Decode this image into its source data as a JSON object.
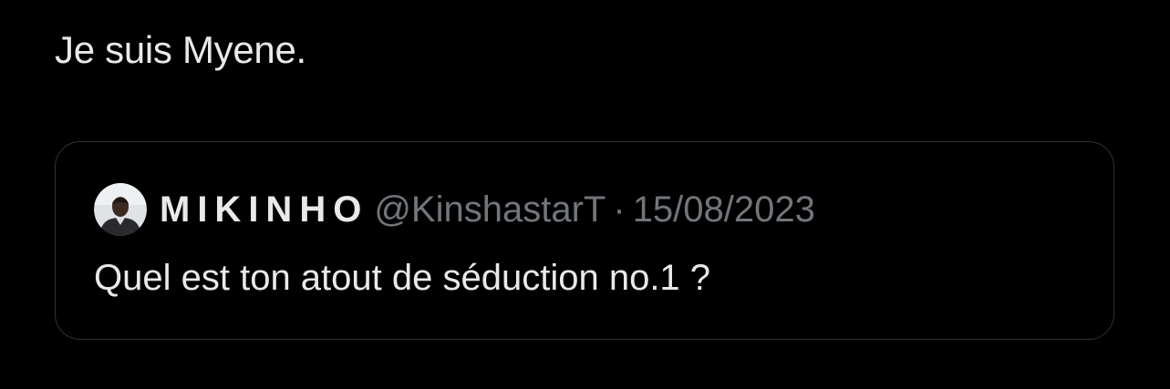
{
  "tweet": {
    "text": "Je suis Myene."
  },
  "quoted_tweet": {
    "display_name": "MIKINHO",
    "handle": "@KinshastarT",
    "separator": "·",
    "date": "15/08/2023",
    "text": "Quel est ton atout de séduction no.1 ?",
    "avatar_icon": "user-avatar-photo"
  },
  "colors": {
    "background": "#000000",
    "primary_text": "#e7e9ea",
    "secondary_text": "#71767b",
    "card_border": "#2f3336"
  }
}
